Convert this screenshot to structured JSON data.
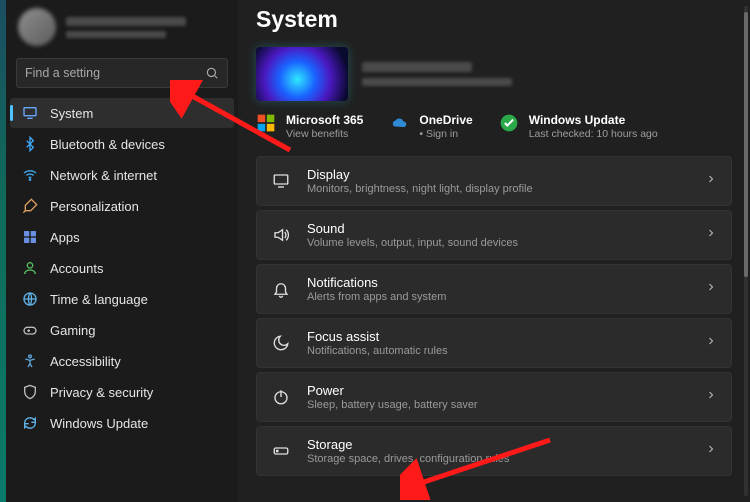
{
  "sidebar": {
    "search_placeholder": "Find a setting",
    "items": [
      {
        "label": "System"
      },
      {
        "label": "Bluetooth & devices"
      },
      {
        "label": "Network & internet"
      },
      {
        "label": "Personalization"
      },
      {
        "label": "Apps"
      },
      {
        "label": "Accounts"
      },
      {
        "label": "Time & language"
      },
      {
        "label": "Gaming"
      },
      {
        "label": "Accessibility"
      },
      {
        "label": "Privacy & security"
      },
      {
        "label": "Windows Update"
      }
    ]
  },
  "main": {
    "title": "System",
    "promo": [
      {
        "title": "Microsoft 365",
        "sub": "View benefits"
      },
      {
        "title": "OneDrive",
        "sub": "• Sign in"
      },
      {
        "title": "Windows Update",
        "sub": "Last checked: 10 hours ago"
      }
    ],
    "settings": [
      {
        "title": "Display",
        "sub": "Monitors, brightness, night light, display profile"
      },
      {
        "title": "Sound",
        "sub": "Volume levels, output, input, sound devices"
      },
      {
        "title": "Notifications",
        "sub": "Alerts from apps and system"
      },
      {
        "title": "Focus assist",
        "sub": "Notifications, automatic rules"
      },
      {
        "title": "Power",
        "sub": "Sleep, battery usage, battery saver"
      },
      {
        "title": "Storage",
        "sub": "Storage space, drives, configuration rules"
      }
    ]
  }
}
